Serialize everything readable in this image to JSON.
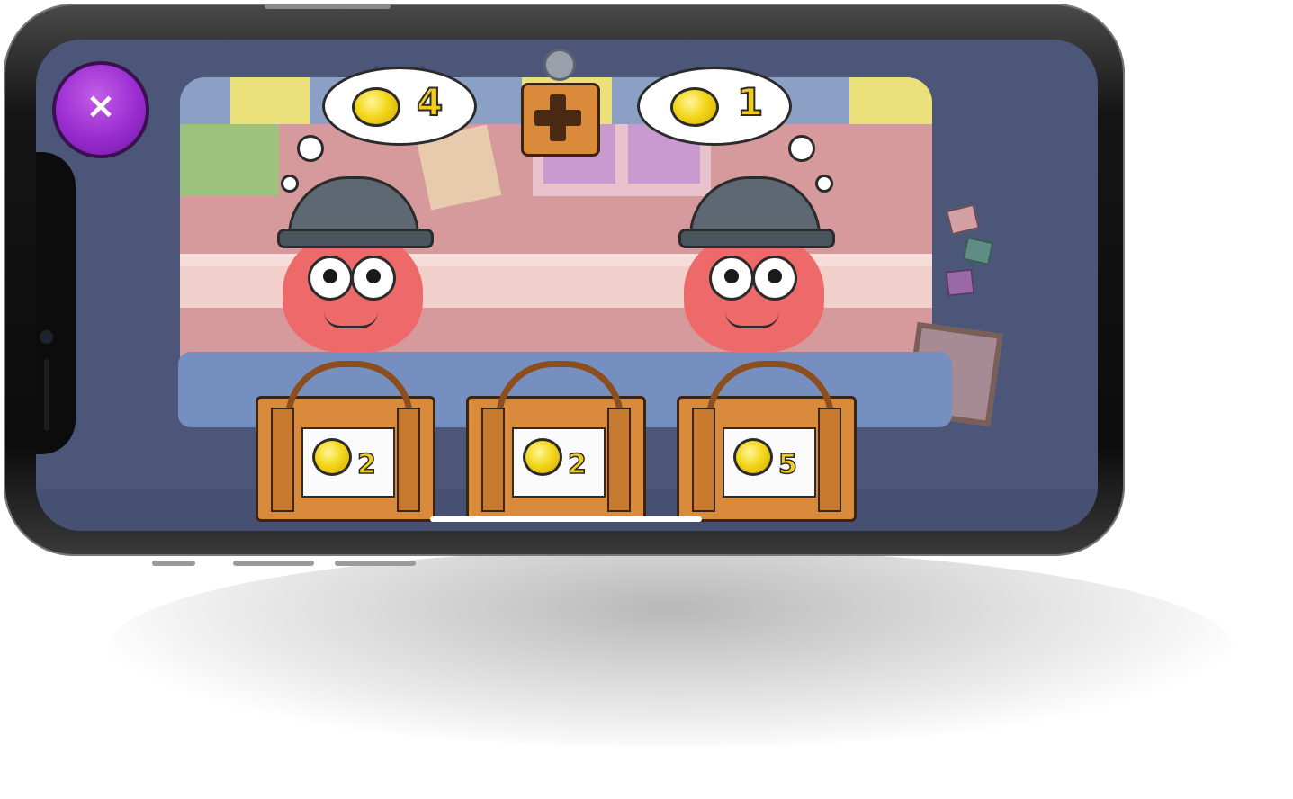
{
  "game": {
    "close_button": {
      "label": "×"
    },
    "operator": {
      "icon": "plus-icon"
    },
    "thought_bubbles": [
      {
        "coin_icon": "coin-icon",
        "value": "4"
      },
      {
        "coin_icon": "coin-icon",
        "value": "1"
      }
    ],
    "crates": [
      {
        "coin_icon": "coin-icon",
        "value": "2"
      },
      {
        "coin_icon": "coin-icon",
        "value": "2"
      },
      {
        "coin_icon": "coin-icon",
        "value": "5"
      }
    ]
  },
  "colors": {
    "screen_bg": "#4b5678",
    "close_button": "#9a2cd0",
    "coin": "#f3d81c",
    "crate_wood": "#d98a3a",
    "monster_body": "#ee6a6a"
  }
}
